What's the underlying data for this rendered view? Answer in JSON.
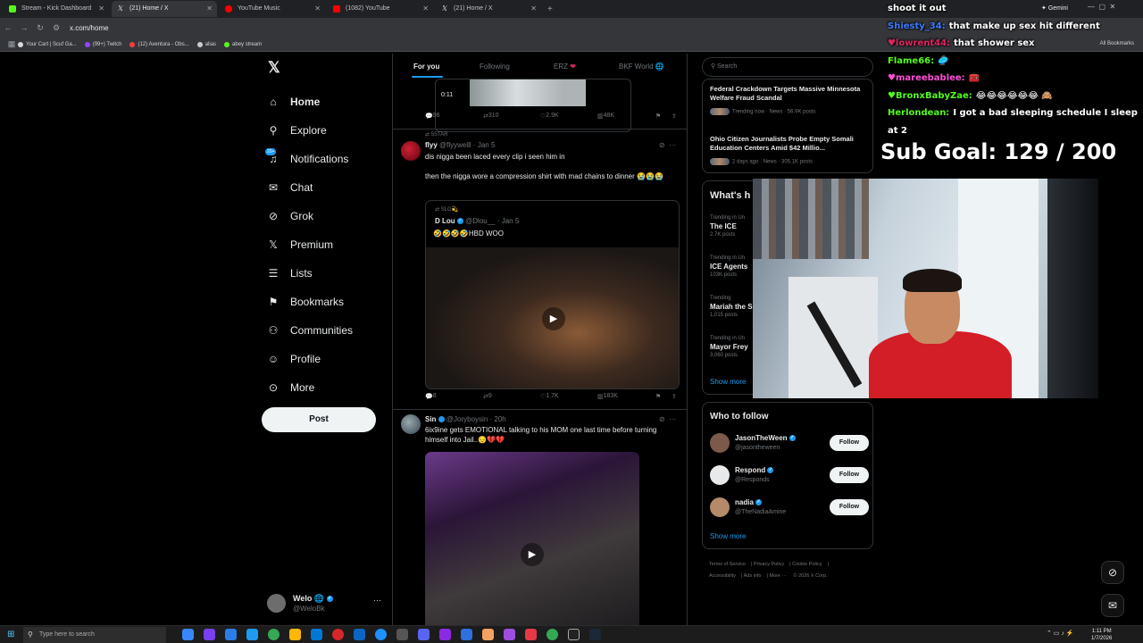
{
  "browser": {
    "tabs": [
      {
        "label": "Stream - Kick Dashboard",
        "color": "#53fc18"
      },
      {
        "label": "(21) Home / X",
        "color": "#e7e9ea"
      },
      {
        "label": "YouTube Music",
        "color": "#ff0000"
      },
      {
        "label": "(1082) YouTube",
        "color": "#ff0000"
      },
      {
        "label": "(21) Home / X",
        "color": "#e7e9ea"
      }
    ],
    "new_tab": "+",
    "url": "x.com/home",
    "bookmarks": [
      {
        "label": "Your Cart | Scuf Ga...",
        "color": "#d8d8d8"
      },
      {
        "label": "(99+) Twitch",
        "color": "#9146ff"
      },
      {
        "label": "(12) Aventura - Obs...",
        "color": "#ff3d3d"
      },
      {
        "label": "alias",
        "color": "#cccccc"
      },
      {
        "label": "abey stream",
        "color": "#53fc18"
      }
    ],
    "all_bookmarks": "All Bookmarks",
    "gemini": "Gemini"
  },
  "nav": {
    "items": [
      {
        "label": "Home",
        "icon": "home-icon"
      },
      {
        "label": "Explore",
        "icon": "search-icon"
      },
      {
        "label": "Notifications",
        "icon": "bell-icon"
      },
      {
        "label": "Chat",
        "icon": "mail-icon"
      },
      {
        "label": "Grok",
        "icon": "grok-icon"
      },
      {
        "label": "Premium",
        "icon": "x-icon"
      },
      {
        "label": "Lists",
        "icon": "list-icon"
      },
      {
        "label": "Bookmarks",
        "icon": "bookmark-icon"
      },
      {
        "label": "Communities",
        "icon": "people-icon"
      },
      {
        "label": "Profile",
        "icon": "user-icon"
      },
      {
        "label": "More",
        "icon": "more-icon"
      }
    ],
    "notif_badge": "20+",
    "post": "Post",
    "account": {
      "name": "Welo",
      "handle": "@WeloBk"
    }
  },
  "feed": {
    "tabs": [
      "For you",
      "Following",
      "ERZ",
      "BKF World"
    ],
    "clip_duration": "0:11",
    "tweet0_stats": {
      "replies": "96",
      "reposts": "310",
      "likes": "2.9K",
      "views": "48K"
    },
    "tweet1": {
      "context": "5STAR",
      "name": "flyy",
      "handle": "@flyywelll · Jan 5",
      "text": "dis nigga been laced every clip i seen him in",
      "text2": "then the nigga wore a compression shirt with mad chains to dinner 😭😭😭",
      "quote_context": "SLG💫",
      "quote_name": "D Lou",
      "quote_handle": "@Dlou__ · Jan 5",
      "quote_text": "🤣🤣🤣🤣HBD WOO",
      "stats": {
        "replies": "8",
        "reposts": "9",
        "likes": "1.7K",
        "views": "183K"
      }
    },
    "tweet2": {
      "name": "Sin",
      "handle": "@Joryboysin · 20h",
      "text": "6ix9ine gets EMOTIONAL talking to his MOM one last time before turning himself into Jail..😔💔💔"
    }
  },
  "right": {
    "search_placeholder": "Search",
    "trends_top": [
      {
        "headline": "Federal Crackdown Targets Massive Minnesota Welfare Fraud Scandal",
        "meta": "Trending now · News · 56.9K posts"
      },
      {
        "headline": "Ohio Citizen Journalists Probe Empty Somali Education Centers Amid $42 Millio...",
        "meta": "2 days ago · News · 305.1K posts"
      }
    ],
    "whats_title": "What's h",
    "trends": [
      {
        "cat": "Trending in Un",
        "name": "The ICE",
        "posts": "2.7K posts"
      },
      {
        "cat": "Trending in Un",
        "name": "ICE Agents",
        "posts": "103K posts"
      },
      {
        "cat": "Trending",
        "name": "Mariah the S",
        "posts": "1,015 posts"
      },
      {
        "cat": "Trending in Un",
        "name": "Mayor Frey",
        "posts": "3,060 posts"
      }
    ],
    "show_more": "Show more",
    "who_title": "Who to follow",
    "follow": [
      {
        "name": "JasonTheWeen",
        "handle": "@jasontheween",
        "btn": "Follow"
      },
      {
        "name": "Respond",
        "handle": "@Responds",
        "btn": "Follow"
      },
      {
        "name": "nadia",
        "handle": "@TheNadiaAmine",
        "btn": "Follow"
      }
    ],
    "show_more2": "Show more",
    "footer": [
      "Terms of Service",
      "Privacy Policy",
      "Cookie Policy",
      "Accessibility",
      "Ads info",
      "More ···",
      "© 2026 X Corp."
    ]
  },
  "overlay": {
    "chat": [
      {
        "user": "",
        "msg": "shoot it out",
        "ucolor": "#ffffff"
      },
      {
        "user": "Shiesty_34:",
        "msg": "that make up sex hit different",
        "ucolor": "#3a7bff"
      },
      {
        "user": "♥lowrent44:",
        "msg": "that shower sex",
        "ucolor": "#e0245e"
      },
      {
        "user": "Flame66:",
        "msg": "🥏",
        "ucolor": "#53fc18"
      },
      {
        "user": "♥mareebablee:",
        "msg": "🧰",
        "ucolor": "#ff4fd8"
      },
      {
        "user": "♥BronxBabyZae:",
        "msg": "😂😂😂😂😂😂 🙈",
        "ucolor": "#53fc18"
      },
      {
        "user": "Herlondean:",
        "msg": "I got a bad sleeping schedule I sleep at 2",
        "ucolor": "#53fc18"
      }
    ],
    "sub_goal": "Sub Goal:  129 / 200"
  },
  "taskbar": {
    "search": "Type here to search",
    "time": "1:11 PM",
    "date": "1/7/2026"
  }
}
